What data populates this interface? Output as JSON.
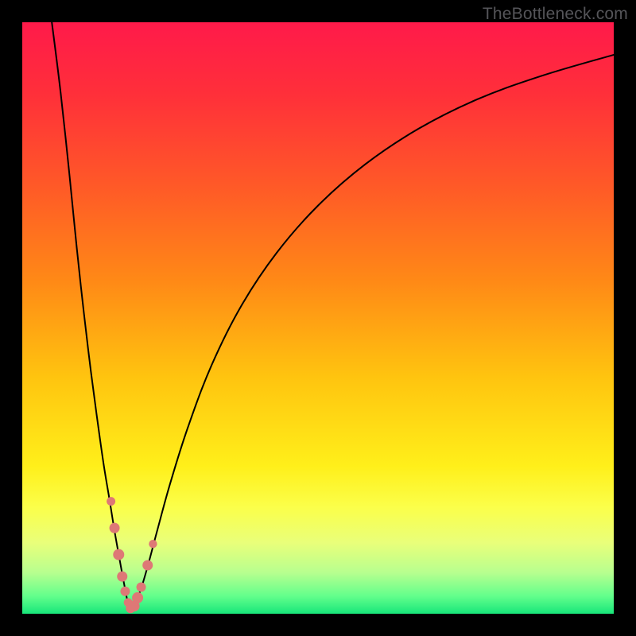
{
  "watermark": "TheBottleneck.com",
  "chart_data": {
    "type": "line",
    "title": "",
    "xlabel": "",
    "ylabel": "",
    "xlim": [
      0,
      100
    ],
    "ylim": [
      0,
      100
    ],
    "gradient_stops": [
      {
        "offset": 0.0,
        "color": "#ff1a4a"
      },
      {
        "offset": 0.12,
        "color": "#ff2f3a"
      },
      {
        "offset": 0.28,
        "color": "#ff5a27"
      },
      {
        "offset": 0.44,
        "color": "#ff8a16"
      },
      {
        "offset": 0.6,
        "color": "#ffc40f"
      },
      {
        "offset": 0.75,
        "color": "#ffef1a"
      },
      {
        "offset": 0.82,
        "color": "#fbff4a"
      },
      {
        "offset": 0.88,
        "color": "#e9ff7a"
      },
      {
        "offset": 0.93,
        "color": "#b8ff8f"
      },
      {
        "offset": 0.97,
        "color": "#63ff8c"
      },
      {
        "offset": 1.0,
        "color": "#18e67a"
      }
    ],
    "series": [
      {
        "name": "left-branch",
        "x": [
          5.0,
          6.5,
          8.0,
          9.2,
          10.4,
          11.6,
          12.8,
          13.8,
          14.8,
          15.6,
          16.4,
          17.0,
          17.5,
          17.9
        ],
        "y": [
          100,
          88,
          74,
          62,
          51,
          41,
          32,
          25,
          19,
          14,
          9.5,
          6.2,
          3.6,
          1.7
        ]
      },
      {
        "name": "right-branch",
        "x": [
          19.0,
          20.0,
          21.2,
          22.8,
          25.0,
          28.0,
          32.0,
          37.0,
          43.0,
          50.0,
          58.0,
          67.0,
          77.0,
          88.0,
          100.0
        ],
        "y": [
          1.7,
          4.0,
          8.0,
          14.0,
          22.0,
          31.5,
          42.0,
          52.0,
          61.0,
          69.0,
          76.0,
          82.0,
          87.0,
          91.0,
          94.5
        ]
      }
    ],
    "optimum_x": 18.45,
    "markers": {
      "name": "highlighted-points",
      "color": "#de7876",
      "points": [
        {
          "x": 15.0,
          "y": 19.0,
          "r": 5.5
        },
        {
          "x": 15.6,
          "y": 14.5,
          "r": 6.5
        },
        {
          "x": 16.3,
          "y": 10.0,
          "r": 7.0
        },
        {
          "x": 16.9,
          "y": 6.3,
          "r": 6.5
        },
        {
          "x": 17.4,
          "y": 3.8,
          "r": 6.0
        },
        {
          "x": 17.9,
          "y": 1.9,
          "r": 5.5
        },
        {
          "x": 18.3,
          "y": 0.9,
          "r": 6.0
        },
        {
          "x": 18.9,
          "y": 1.3,
          "r": 7.0
        },
        {
          "x": 19.5,
          "y": 2.7,
          "r": 7.0
        },
        {
          "x": 20.1,
          "y": 4.5,
          "r": 6.0
        },
        {
          "x": 21.2,
          "y": 8.2,
          "r": 6.5
        },
        {
          "x": 22.1,
          "y": 11.8,
          "r": 5.2
        }
      ]
    }
  }
}
